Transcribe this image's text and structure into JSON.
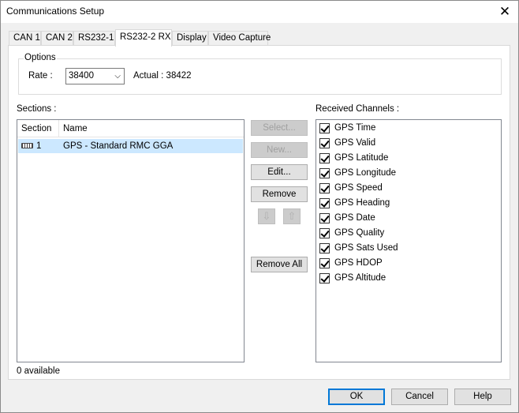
{
  "window": {
    "title": "Communications Setup"
  },
  "tabs": [
    {
      "label": "CAN 1"
    },
    {
      "label": "CAN 2"
    },
    {
      "label": "RS232-1"
    },
    {
      "label": "RS232-2 RX",
      "active": true
    },
    {
      "label": "Display"
    },
    {
      "label": "Video Capture"
    }
  ],
  "options": {
    "legend": "Options",
    "rate_label": "Rate :",
    "rate_value": "38400",
    "actual_label": "Actual : 38422"
  },
  "sections": {
    "label": "Sections :",
    "columns": [
      "Section",
      "Name"
    ],
    "rows": [
      {
        "section": "1",
        "name": "GPS - Standard RMC GGA",
        "icon": "serial-port-icon"
      }
    ],
    "available_text": "0 available"
  },
  "buttons": {
    "select": "Select...",
    "new": "New...",
    "edit": "Edit...",
    "remove": "Remove",
    "remove_all": "Remove All",
    "move_down_icon": "arrow-down-icon",
    "move_up_icon": "arrow-up-icon"
  },
  "received_channels": {
    "label": "Received Channels :",
    "items": [
      {
        "label": "GPS Time",
        "checked": true
      },
      {
        "label": "GPS Valid",
        "checked": true
      },
      {
        "label": "GPS Latitude",
        "checked": true
      },
      {
        "label": "GPS Longitude",
        "checked": true
      },
      {
        "label": "GPS Speed",
        "checked": true
      },
      {
        "label": "GPS Heading",
        "checked": true
      },
      {
        "label": "GPS Date",
        "checked": true
      },
      {
        "label": "GPS Quality",
        "checked": true
      },
      {
        "label": "GPS Sats Used",
        "checked": true
      },
      {
        "label": "GPS HDOP",
        "checked": true
      },
      {
        "label": "GPS Altitude",
        "checked": true
      }
    ]
  },
  "footer": {
    "ok": "OK",
    "cancel": "Cancel",
    "help": "Help"
  },
  "colors": {
    "selection": "#cce8ff",
    "default_button_border": "#0078d7"
  }
}
